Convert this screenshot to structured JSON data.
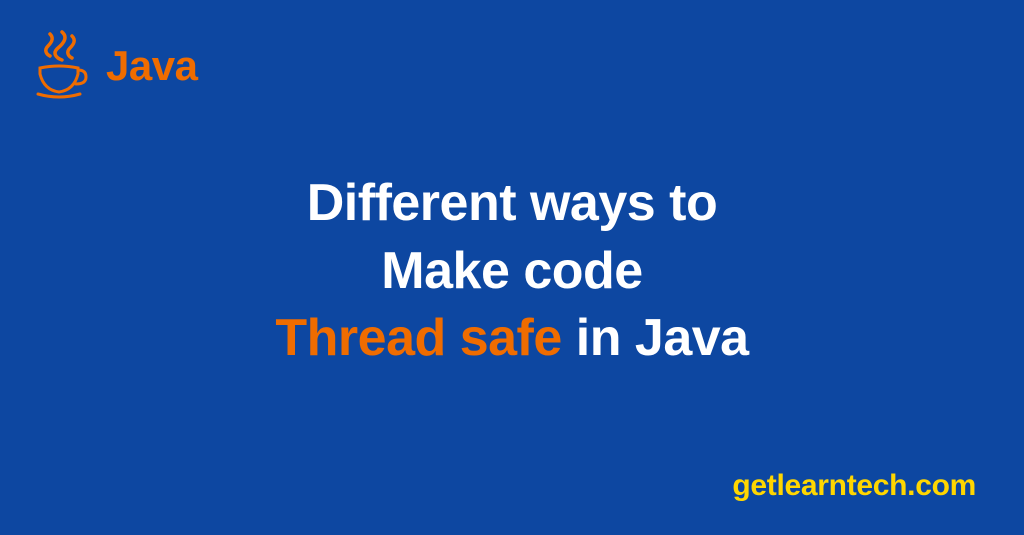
{
  "logo": {
    "text": "Java"
  },
  "title": {
    "line1": "Different ways to",
    "line2": "Make code",
    "line3_highlight": "Thread safe",
    "line3_tail": " in Java"
  },
  "footer": {
    "site": "getlearntech.com"
  },
  "colors": {
    "background": "#0d47a1",
    "accent_orange": "#ef6c00",
    "accent_yellow": "#ffd600",
    "text_white": "#ffffff"
  }
}
